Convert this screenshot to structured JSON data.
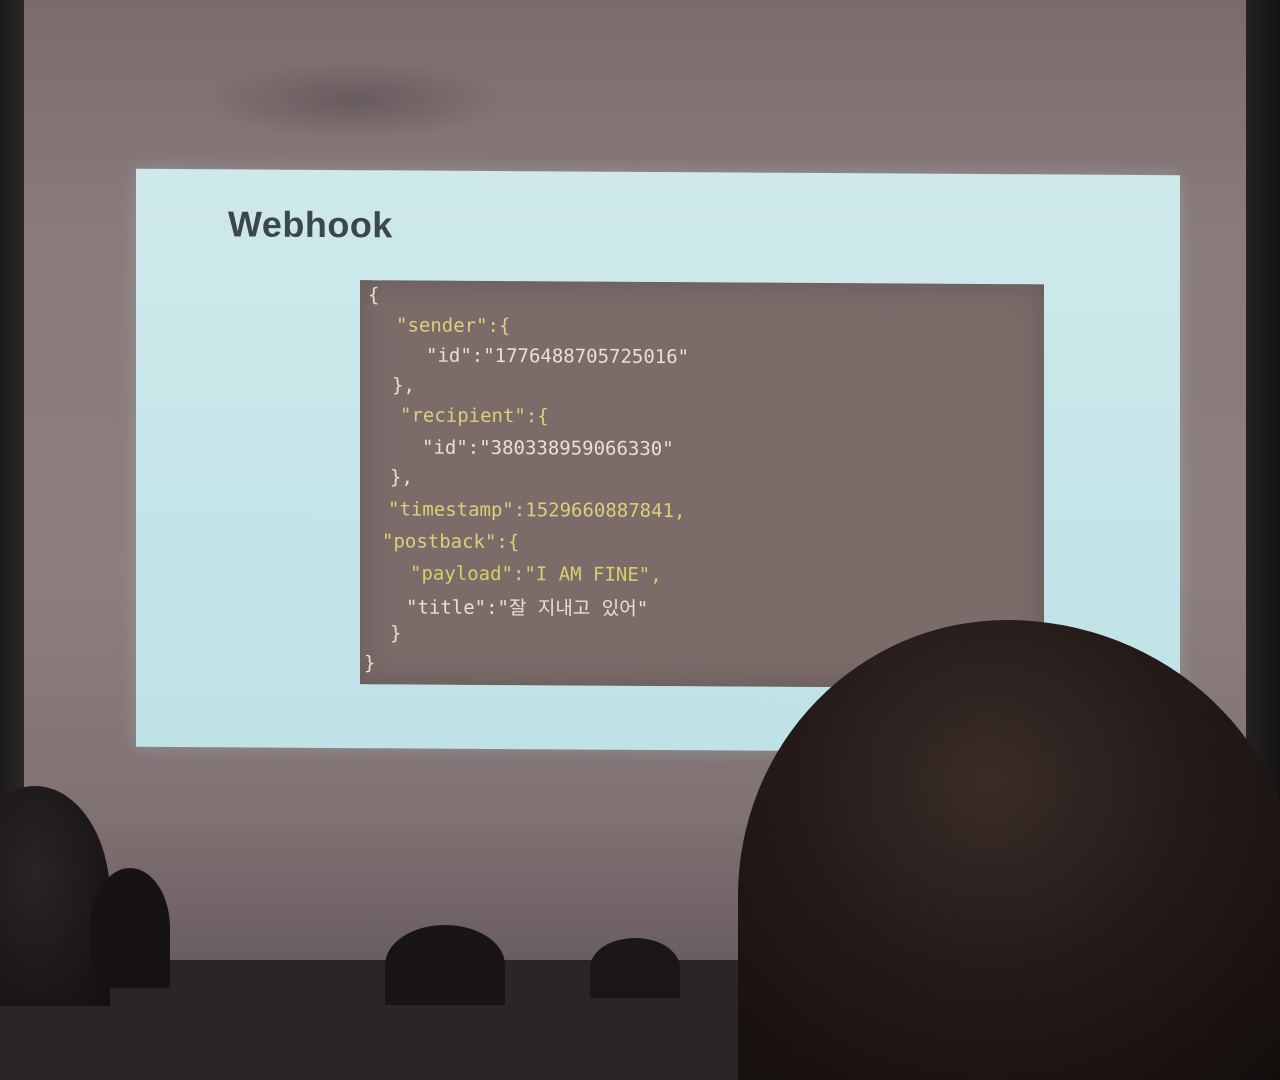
{
  "slide": {
    "title": "Webhook",
    "code_lines": [
      "{",
      "\"sender\":{",
      "\"id\":\"1776488705725016\"",
      "},",
      "\"recipient\":{",
      "\"id\":\"380338959066330\"",
      "},",
      "\"timestamp\":1529660887841,",
      "\"postback\":{",
      "\"payload\":\"I AM FINE\",",
      "\"title\":\"잘 지내고 있어\"",
      "}",
      "}"
    ]
  }
}
